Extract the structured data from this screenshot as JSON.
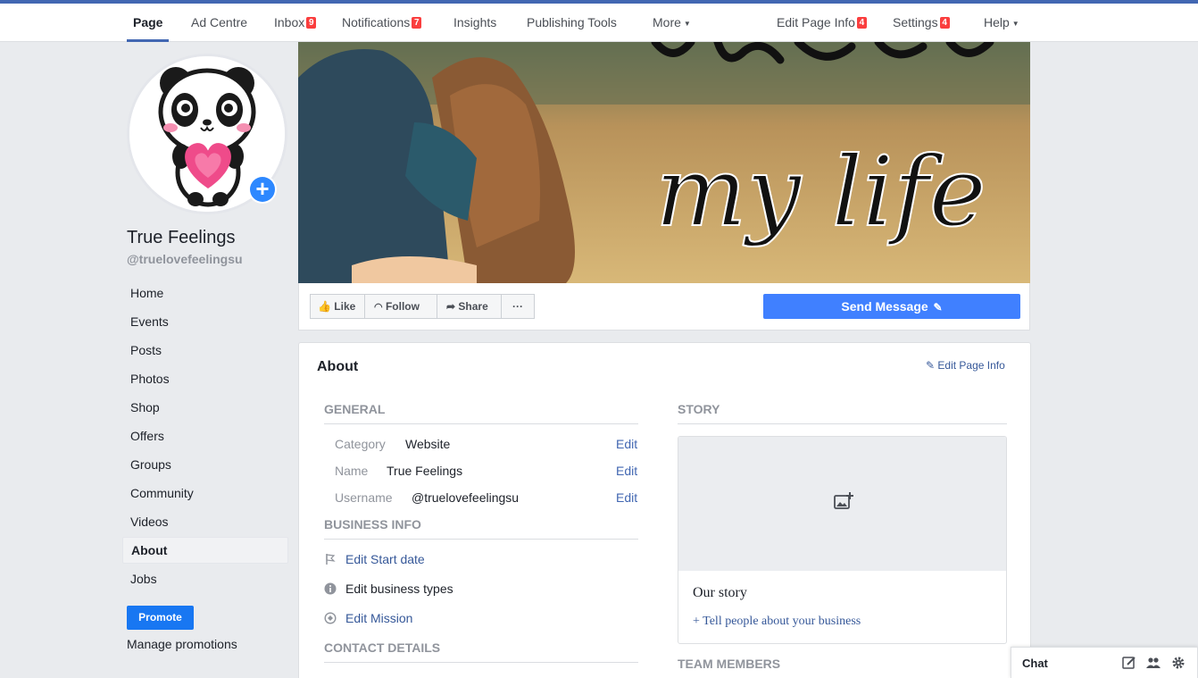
{
  "nav": {
    "page": "Page",
    "ad_centre": "Ad Centre",
    "inbox": "Inbox",
    "inbox_badge": "9",
    "notifications": "Notifications",
    "notifications_badge": "7",
    "insights": "Insights",
    "publishing_tools": "Publishing Tools",
    "more": "More",
    "edit_page_info": "Edit Page Info",
    "edit_page_info_badge": "4",
    "settings": "Settings",
    "settings_badge": "4",
    "help": "Help"
  },
  "profile": {
    "name": "True Feelings",
    "username": "@truelovefeelingsu"
  },
  "sidebar": {
    "items": [
      {
        "label": "Home"
      },
      {
        "label": "Events"
      },
      {
        "label": "Posts"
      },
      {
        "label": "Photos"
      },
      {
        "label": "Shop"
      },
      {
        "label": "Offers"
      },
      {
        "label": "Groups"
      },
      {
        "label": "Community"
      },
      {
        "label": "Videos"
      },
      {
        "label": "About"
      },
      {
        "label": "Jobs"
      }
    ],
    "promote": "Promote",
    "manage_promotions": "Manage promotions"
  },
  "cover": {
    "text": "my life"
  },
  "actions": {
    "like": "Like",
    "follow": "Follow",
    "share": "Share",
    "more": "···",
    "send_message": "Send Message"
  },
  "about": {
    "title": "About",
    "edit_page_info": "Edit Page Info",
    "general": {
      "heading": "GENERAL",
      "rows": [
        {
          "label": "Category",
          "value": "Website",
          "edit": "Edit"
        },
        {
          "label": "Name",
          "value": "True Feelings",
          "edit": "Edit"
        },
        {
          "label": "Username",
          "value": "@truelovefeelingsu",
          "edit": "Edit"
        }
      ]
    },
    "business_info": {
      "heading": "BUSINESS INFO",
      "start_date": "Edit Start date",
      "business_types": "Edit business types",
      "mission": "Edit Mission"
    },
    "contact_details": {
      "heading": "CONTACT DETAILS"
    },
    "story": {
      "heading": "STORY",
      "title": "Our story",
      "link": "+ Tell people about your business"
    },
    "team_members": {
      "heading": "TEAM MEMBERS"
    }
  },
  "chat": {
    "label": "Chat"
  },
  "colors": {
    "brand": "#4267b2",
    "send_button": "#4080ff",
    "promote": "#1877f2",
    "badge": "#fa3e3e",
    "link": "#365899"
  }
}
